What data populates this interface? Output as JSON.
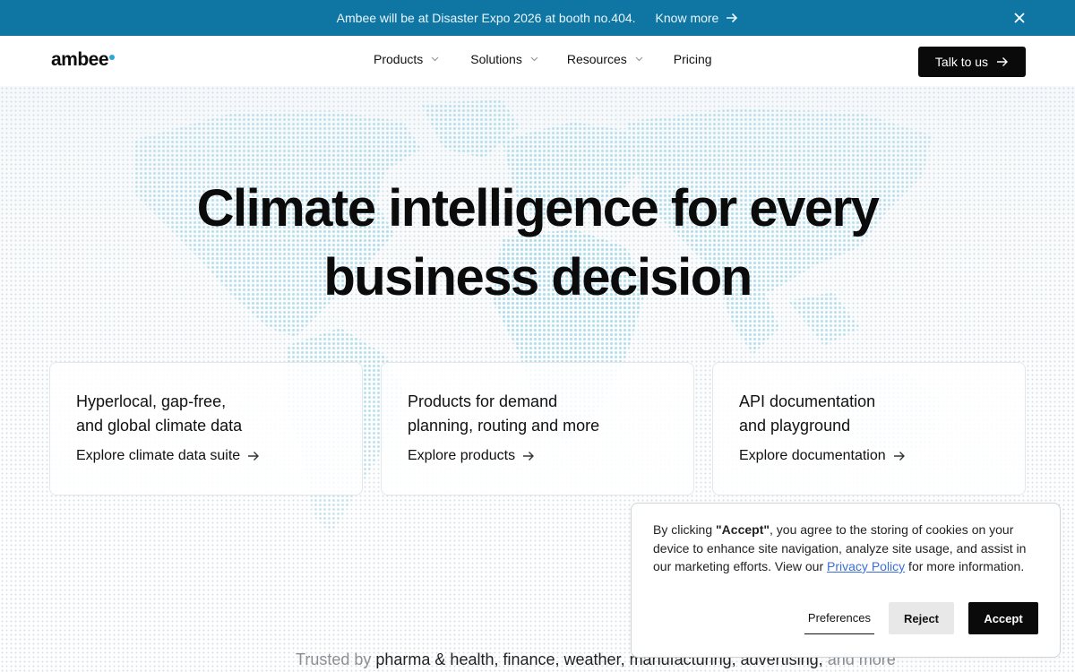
{
  "announcement": {
    "message": "Ambee will be at Disaster Expo 2026 at booth no.404.",
    "link_label": "Know more",
    "icons": [
      "arrow-right-icon",
      "close-icon"
    ]
  },
  "header": {
    "logo": "ambee",
    "nav": [
      {
        "label": "Products",
        "has_dropdown": true
      },
      {
        "label": "Solutions",
        "has_dropdown": true
      },
      {
        "label": "Resources",
        "has_dropdown": true
      },
      {
        "label": "Pricing",
        "has_dropdown": false
      }
    ],
    "cta_label": "Talk to us"
  },
  "hero": {
    "headline_line1": "Climate intelligence for every",
    "headline_line2": "business decision",
    "cards": [
      {
        "title_line1": "Hyperlocal, gap-free,",
        "title_line2": "and global climate data",
        "link": "Explore climate data suite"
      },
      {
        "title_line1": "Products for demand",
        "title_line2": "planning, routing and more",
        "link": "Explore products"
      },
      {
        "title_line1": "API documentation",
        "title_line2": "and playground",
        "link": "Explore documentation"
      }
    ]
  },
  "trusted": {
    "prefix": "Trusted by",
    "industries": "pharma & health, finance, weather, manufacturing, advertising,",
    "suffix": "and more"
  },
  "cookie": {
    "text_before": "By clicking ",
    "accept_quote": "\"Accept\"",
    "text_middle": ", you agree to the storing of cookies on your device to enhance site navigation, analyze site usage, and assist in our marketing efforts. View our ",
    "privacy_link": "Privacy Policy",
    "text_after": " for more information.",
    "preferences_label": "Preferences",
    "reject_label": "Reject",
    "accept_label": "Accept"
  },
  "colors": {
    "announcement_bg": "#0f76a3",
    "accent": "#2aa9d8",
    "cta_bg": "#0a0a0a",
    "link_blue": "#3b6fd8"
  }
}
